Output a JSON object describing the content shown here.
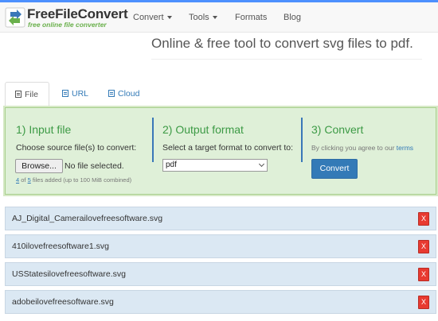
{
  "brand": {
    "title": "FreeFileConvert",
    "subtitle": "free online file converter",
    "accent": "#4d90fe"
  },
  "nav": {
    "items": [
      {
        "label": "Convert",
        "dropdown": true
      },
      {
        "label": "Tools",
        "dropdown": true
      },
      {
        "label": "Formats",
        "dropdown": false
      },
      {
        "label": "Blog",
        "dropdown": false
      }
    ]
  },
  "tagline": "Online & free tool to convert svg files to pdf.",
  "tabs": [
    {
      "label": "File",
      "active": true,
      "icon": "file-icon"
    },
    {
      "label": "URL",
      "active": false,
      "icon": "link-icon"
    },
    {
      "label": "Cloud",
      "active": false,
      "icon": "cloud-icon"
    }
  ],
  "step1": {
    "title": "1) Input file",
    "desc": "Choose source file(s) to convert:",
    "browse_label": "Browse...",
    "file_status": "No file selected.",
    "counter_current": "4",
    "counter_of": "of",
    "counter_max": "5",
    "counter_suffix": "files added (up to 100 MiB combined)"
  },
  "step2": {
    "title": "2) Output format",
    "desc": "Select a target format to convert to:",
    "selected_format": "pdf"
  },
  "step3": {
    "title": "3) Convert",
    "agree_text": "By clicking you agree to our",
    "terms_label": "terms",
    "convert_label": "Convert"
  },
  "files": [
    {
      "name": "AJ_Digital_Camerailovefreesoftware.svg",
      "remove_label": "X"
    },
    {
      "name": "410ilovefreesoftware1.svg",
      "remove_label": "X"
    },
    {
      "name": "USStatesilovefreesoftware.svg",
      "remove_label": "X"
    },
    {
      "name": "adobeilovefreesoftware.svg",
      "remove_label": "X"
    }
  ]
}
